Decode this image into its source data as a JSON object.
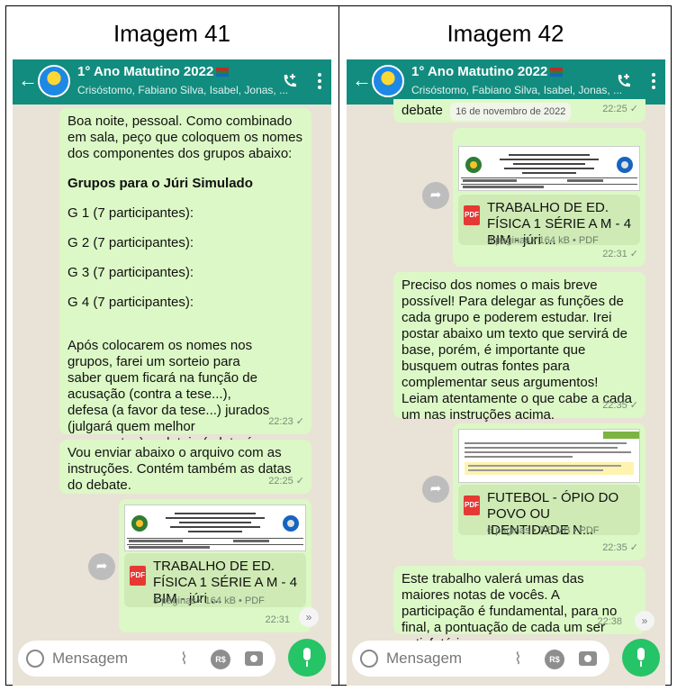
{
  "captions": {
    "left": "Imagem 41",
    "right": "Imagem 42"
  },
  "chat": {
    "title": "1° Ano Matutino 2022",
    "subtitle": "Crisóstomo, Fabiano Silva, Isabel, Jonas, ...",
    "input_placeholder": "Mensagem"
  },
  "left": {
    "msg1": {
      "intro": "Boa noite, pessoal. Como combinado em sala, peço que coloquem os nomes dos componentes dos grupos abaixo:",
      "heading": "Grupos para o Júri Simulado",
      "g1": "G 1 (7 participantes):",
      "g2": "G 2 (7 participantes):",
      "g3": "G 3 (7 participantes):",
      "g4": "G 4 (7 participantes):",
      "body": "Após colocarem os nomes nos grupos, farei um sorteio para saber quem ficará na função de acusação (contra a tese...), defesa (a favor da tese...) jurados (julgará quem melhor argumentou) e plateia (relatará o debate...)",
      "time": "22:23 ✓"
    },
    "msg2": {
      "text": "Vou enviar abaixo o arquivo com as instruções. Contém também as datas do debate.",
      "time": "22:25 ✓"
    },
    "doc1": {
      "title": "TRABALHO DE ED. FÍSICA 1 SÉRIE A M - 4 BIM - júri ...",
      "meta": "3 páginas • 164 kB • PDF",
      "time": "22:31"
    }
  },
  "right": {
    "msg_top": {
      "text": "debate",
      "date": "16 de novembro de 2022",
      "time": "22:25 ✓"
    },
    "doc1": {
      "title": "TRABALHO DE ED. FÍSICA 1 SÉRIE A M - 4 BIM - júri ...",
      "meta": "3 páginas • 164 kB • PDF",
      "time": "22:31 ✓"
    },
    "msg2": {
      "text": "Preciso dos nomes o mais breve possível! Para delegar as funções de cada grupo e poderem estudar. Irei postar abaixo um texto que servirá de base, porém, é importante que busquem outras fontes para complementar seus argumentos! Leiam atentamente o que cabe a cada um nas instruções acima.",
      "time": "22:35 ✓"
    },
    "doc2": {
      "title": "FUTEBOL - ÓPIO DO POVO OU IDENTIDADE N...",
      "meta": "6 páginas • 7,5 MB • PDF",
      "time": "22:35 ✓"
    },
    "msg3": {
      "text": "Este trabalho valerá umas das maiores notas de vocês. A participação é fundamental, para no final, a pontuação de cada um ser satisfatória.",
      "time": "22:38"
    }
  },
  "icons": {
    "back": "arrow-left-icon",
    "call": "add-call-icon",
    "menu": "more-vert-icon",
    "forward": "share-icon",
    "pdf": "pdf-icon",
    "emoji": "emoji-icon",
    "attach": "paperclip-icon",
    "payment": "rs-payment-icon",
    "camera": "camera-icon",
    "mic": "mic-icon",
    "scroll": "chevron-double-down-icon"
  },
  "colors": {
    "header": "#128c7e",
    "chat_bg": "#e9e2d6",
    "bubble": "#dcf8c6",
    "mic": "#25c466"
  }
}
